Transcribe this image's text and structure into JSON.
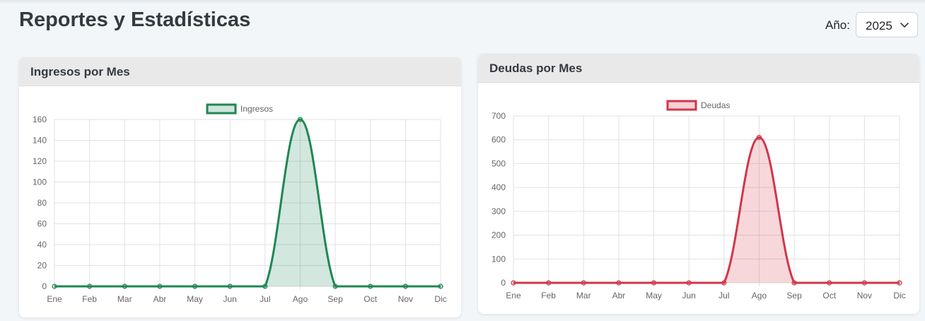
{
  "page": {
    "title": "Reportes y Estadísticas"
  },
  "year": {
    "label": "Año:",
    "selected": "2025"
  },
  "charts": [
    {
      "header": "Ingresos por Mes",
      "color": "#1e8754",
      "fill": "rgba(30,135,84,0.20)",
      "legend_fill": "#cfe5d9"
    },
    {
      "header": "Deudas por Mes",
      "color": "#d1364a",
      "fill": "rgba(220,53,69,0.20)",
      "legend_fill": "#f8d1d6"
    }
  ],
  "chart_data": [
    {
      "type": "area",
      "categories": [
        "Ene",
        "Feb",
        "Mar",
        "Abr",
        "May",
        "Jun",
        "Jul",
        "Ago",
        "Sep",
        "Oct",
        "Nov",
        "Dic"
      ],
      "series": [
        {
          "name": "Ingresos",
          "values": [
            0,
            0,
            0,
            0,
            0,
            0,
            0,
            160,
            0,
            0,
            0,
            0
          ]
        }
      ],
      "ylim": [
        0,
        160
      ],
      "yticks": [
        0,
        20,
        40,
        60,
        80,
        100,
        120,
        140,
        160
      ],
      "grid": true,
      "legend": "top-center"
    },
    {
      "type": "area",
      "categories": [
        "Ene",
        "Feb",
        "Mar",
        "Abr",
        "May",
        "Jun",
        "Jul",
        "Ago",
        "Sep",
        "Oct",
        "Nov",
        "Dic"
      ],
      "series": [
        {
          "name": "Deudas",
          "values": [
            0,
            0,
            0,
            0,
            0,
            0,
            0,
            610,
            0,
            0,
            0,
            0
          ]
        }
      ],
      "ylim": [
        0,
        700
      ],
      "yticks": [
        0,
        100,
        200,
        300,
        400,
        500,
        600,
        700
      ],
      "grid": true,
      "legend": "top-center"
    }
  ]
}
